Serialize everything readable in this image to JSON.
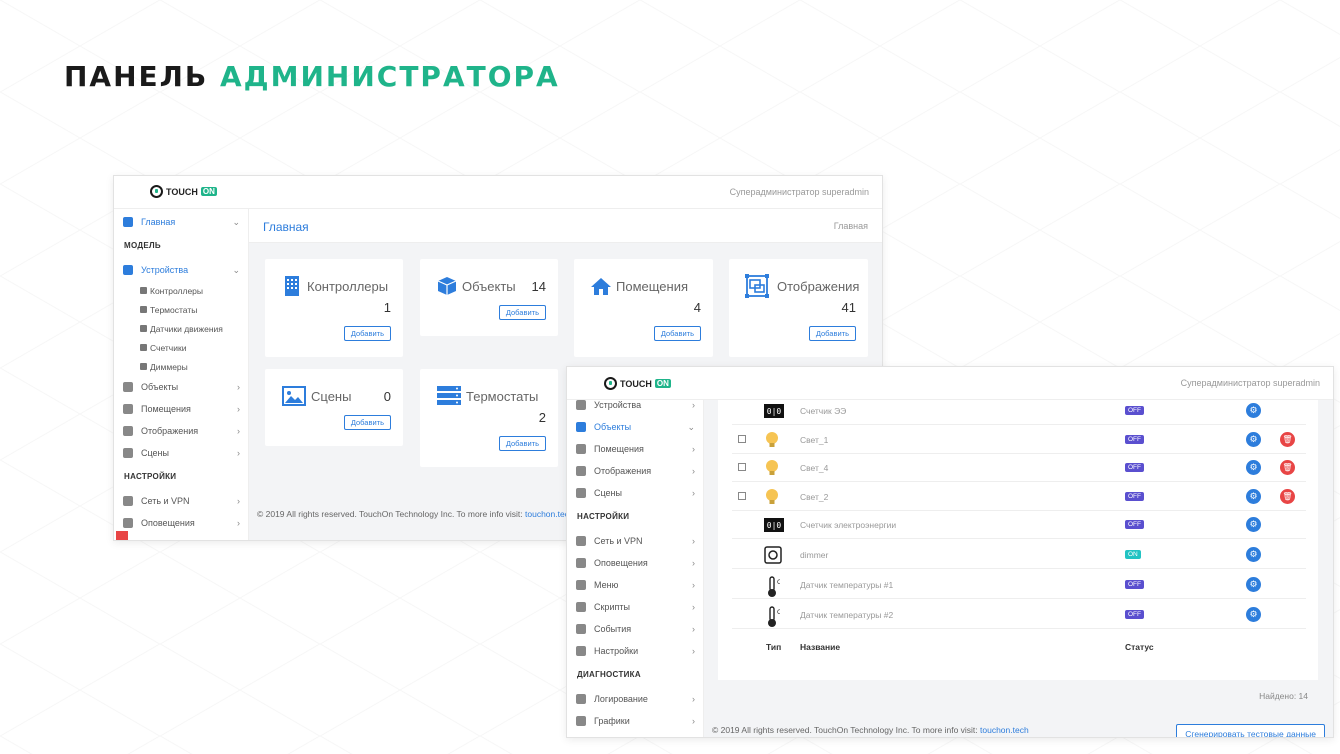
{
  "headline": {
    "part1": "ПАНЕЛЬ",
    "part2": "АДМИНИСТРАТОРА"
  },
  "brand": {
    "touch": "TOUCH",
    "on": "ON"
  },
  "user": "Суперадминистратор superadmin",
  "win1": {
    "sidebar": {
      "main": "Главная",
      "model_head": "МОДЕЛЬ",
      "devices": "Устройства",
      "subs": [
        "Контроллеры",
        "Термостаты",
        "Датчики движения",
        "Счетчики",
        "Диммеры"
      ],
      "objects": "Объекты",
      "rooms": "Помещения",
      "views": "Отображения",
      "scenes": "Сцены",
      "settings_head": "НАСТРОЙКИ",
      "network": "Сеть и VPN",
      "alerts": "Оповещения"
    },
    "page_title": "Главная",
    "crumb": "Главная",
    "cards": [
      {
        "title": "Контроллеры",
        "count": "1",
        "button": "Добавить"
      },
      {
        "title": "Объекты",
        "count": "14",
        "button": "Добавить"
      },
      {
        "title": "Помещения",
        "count": "4",
        "button": "Добавить"
      },
      {
        "title": "Отображения",
        "count": "41",
        "button": "Добавить"
      },
      {
        "title": "Сцены",
        "count": "0",
        "button": "Добавить"
      },
      {
        "title": "Термостаты",
        "count": "2",
        "button": "Добавить"
      }
    ],
    "footer": "© 2019 All rights reserved. TouchOn Technology Inc. To more info visit: ",
    "footer_link": "touchon.tech"
  },
  "win2": {
    "sidebar": {
      "devices": "Устройства",
      "objects": "Объекты",
      "rooms": "Помещения",
      "views": "Отображения",
      "scenes": "Сцены",
      "settings_head": "НАСТРОЙКИ",
      "network": "Сеть и VPN",
      "alerts": "Оповещения",
      "menu": "Меню",
      "scripts": "Скрипты",
      "events": "События",
      "settings": "Настройки",
      "diag_head": "ДИАГНОСТИКА",
      "logging": "Логирование",
      "graphs": "Графики"
    },
    "rows": [
      {
        "name": "Счетчик ЭЭ",
        "status": "OFF",
        "checkbox": false,
        "delete": false,
        "icon": "meter-icon"
      },
      {
        "name": "Свет_1",
        "status": "OFF",
        "checkbox": true,
        "delete": true,
        "icon": "bulb-icon"
      },
      {
        "name": "Свет_4",
        "status": "OFF",
        "checkbox": true,
        "delete": true,
        "icon": "bulb-icon"
      },
      {
        "name": "Свет_2",
        "status": "OFF",
        "checkbox": true,
        "delete": true,
        "icon": "bulb-icon"
      },
      {
        "name": "Счетчик электроэнергии",
        "status": "OFF",
        "checkbox": false,
        "delete": false,
        "icon": "meter-icon"
      },
      {
        "name": "dimmer",
        "status": "ON",
        "checkbox": false,
        "delete": false,
        "icon": "dimmer-icon"
      },
      {
        "name": "Датчик температуры #1",
        "status": "OFF",
        "checkbox": false,
        "delete": false,
        "icon": "thermometer-icon"
      },
      {
        "name": "Датчик температуры #2",
        "status": "OFF",
        "checkbox": false,
        "delete": false,
        "icon": "thermometer-icon"
      }
    ],
    "table_head": {
      "type": "Тип",
      "name": "Название",
      "status": "Статус"
    },
    "found": "Найдено: 14",
    "footer": "© 2019 All rights reserved. TouchOn Technology Inc. To more info visit: ",
    "footer_link": "touchon.tech",
    "generate_button": "Сгенерировать тестовые данные"
  },
  "colors": {
    "accent": "#1fb48a",
    "primary": "#2d7ddc",
    "danger": "#e84545",
    "off": "#5a4fcf",
    "on": "#22c3c3"
  }
}
